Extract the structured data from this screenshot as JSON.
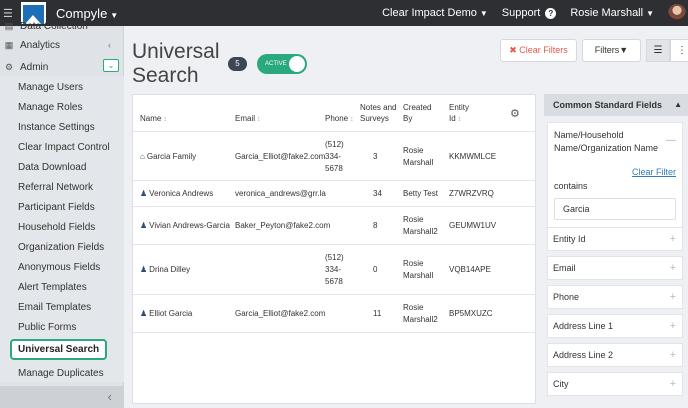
{
  "topbar": {
    "app_name": "Compyle",
    "org": "Clear Impact Demo",
    "support": "Support",
    "user": "Rosie Marshall"
  },
  "sidebar": {
    "top_item": "Data Collection",
    "analytics": "Analytics",
    "admin": "Admin",
    "items": [
      "Manage Users",
      "Manage Roles",
      "Instance Settings",
      "Clear Impact Control",
      "Data Download",
      "Referral Network",
      "Participant Fields",
      "Household Fields",
      "Organization Fields",
      "Anonymous Fields",
      "Alert Templates",
      "Email Templates",
      "Public Forms",
      "Universal Search",
      "Manage Duplicates"
    ],
    "active": "Universal Search"
  },
  "page": {
    "title_line1": "Universal",
    "title_line2": "Search",
    "count": "5",
    "toggle_label": "ACTIVE",
    "clear_filters": "Clear Filters",
    "filters": "Filters"
  },
  "table": {
    "headers": {
      "name": "Name",
      "email": "Email",
      "phone": "Phone",
      "notes_1": "Notes and",
      "notes_2": "Surveys",
      "created_1": "Created",
      "created_2": "By",
      "entity_1": "Entity",
      "entity_2": "Id"
    },
    "rows": [
      {
        "name": "Garcia Family",
        "email": "Garcia_Elliot@fake2.com",
        "phone_1": "(512)",
        "phone_2": "334-",
        "phone_3": "5678",
        "notes": "3",
        "created_1": "Rosie",
        "created_2": "Marshall",
        "entity": "KKMWMLCE"
      },
      {
        "name": "Veronica Andrews",
        "email": "veronica_andrews@grr.la",
        "phone_1": "",
        "phone_2": "",
        "phone_3": "",
        "notes": "34",
        "created_1": "Betty Test",
        "created_2": "",
        "entity": "Z7WRZVRQ"
      },
      {
        "name": "Vivian Andrews-Garcia",
        "email": "Baker_Peyton@fake2.com",
        "phone_1": "",
        "phone_2": "",
        "phone_3": "",
        "notes": "8",
        "created_1": "Rosie",
        "created_2": "Marshall2",
        "entity": "GEUMW1UV"
      },
      {
        "name": "Drina Dilley",
        "email": "",
        "phone_1": "(512)",
        "phone_2": "334-",
        "phone_3": "5678",
        "notes": "0",
        "created_1": "Rosie",
        "created_2": "Marshall",
        "entity": "VQB14APE"
      },
      {
        "name": "Elliot Garcia",
        "email": "Garcia_Elliot@fake2.com",
        "phone_1": "",
        "phone_2": "",
        "phone_3": "",
        "notes": "11",
        "created_1": "Rosie",
        "created_2": "Marshall2",
        "entity": "BP5MXUZC"
      }
    ]
  },
  "filters_panel": {
    "heading": "Common Standard Fields",
    "expanded_label_1": "Name/Household",
    "expanded_label_2": "Name/Organization Name",
    "clear_filter": "Clear Filter",
    "contains": "contains",
    "value": "Garcia",
    "fields": [
      "Entity Id",
      "Email",
      "Phone",
      "Address Line 1",
      "Address Line 2",
      "City"
    ]
  }
}
